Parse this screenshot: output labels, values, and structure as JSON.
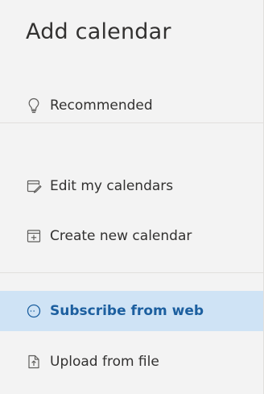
{
  "panel": {
    "title": "Add calendar"
  },
  "nav": {
    "recommended": {
      "label": "Recommended",
      "icon": "lightbulb-icon"
    },
    "edit_calendars": {
      "label": "Edit my calendars",
      "icon": "edit-calendar-icon"
    },
    "create_calendar": {
      "label": "Create new calendar",
      "icon": "calendar-add-icon"
    },
    "subscribe_web": {
      "label": "Subscribe from web",
      "icon": "globe-icon",
      "selected": true
    },
    "upload_file": {
      "label": "Upload from file",
      "icon": "file-upload-icon"
    }
  },
  "colors": {
    "background": "#f3f3f3",
    "selected_background": "#cfe3f5",
    "selected_text": "#1c5f9f",
    "text": "#323130",
    "divider": "#e1dfdd"
  }
}
